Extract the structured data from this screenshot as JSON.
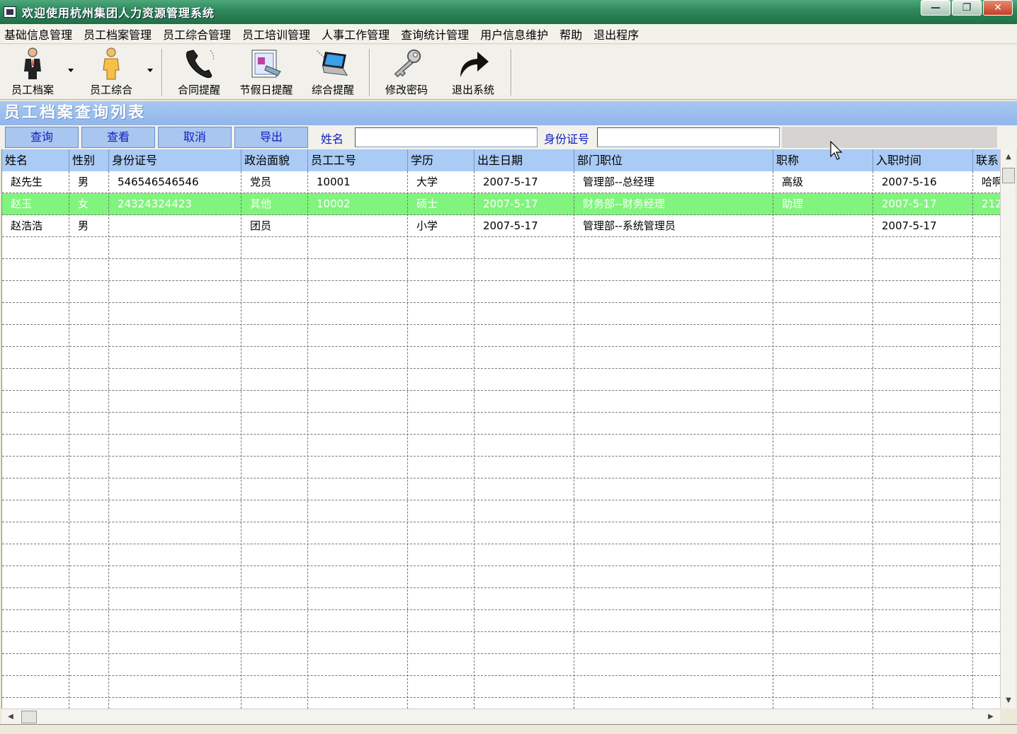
{
  "window": {
    "title": "欢迎使用杭州集团人力资源管理系统",
    "buttons": {
      "minimize": "—",
      "maximize": "❐",
      "close": "✕"
    }
  },
  "menu": [
    "基础信息管理",
    "员工档案管理",
    "员工综合管理",
    "员工培训管理",
    "人事工作管理",
    "查询统计管理",
    "用户信息维护",
    "帮助",
    "退出程序"
  ],
  "toolbar": {
    "employee_file": "员工档案",
    "employee_general": "员工综合",
    "contract_reminder": "合同提醒",
    "holiday_reminder": "节假日提醒",
    "general_reminder": "综合提醒",
    "change_password": "修改密码",
    "exit_system": "退出系统"
  },
  "section": {
    "title": "员工档案查询列表"
  },
  "actions": {
    "query": "查询",
    "view": "查看",
    "cancel": "取消",
    "export": "导出",
    "name_label": "姓名",
    "name_value": "",
    "idcard_label": "身份证号",
    "idcard_value": ""
  },
  "grid": {
    "columns": [
      "姓名",
      "性别",
      "身份证号",
      "政治面貌",
      "员工工号",
      "学历",
      "出生日期",
      "部门职位",
      "职称",
      "入职时间",
      "联系"
    ],
    "rows": [
      [
        "赵先生",
        "男",
        "546546546546",
        "党员",
        "10001",
        "大学",
        "2007-5-17",
        "管理部--总经理",
        "高级",
        "2007-5-16",
        "哈啊"
      ],
      [
        "赵玉",
        "女",
        "24324324423",
        "其他",
        "10002",
        "硕士",
        "2007-5-17",
        "财务部--财务经理",
        "助理",
        "2007-5-17",
        "212"
      ],
      [
        "赵浩浩",
        "男",
        "",
        "团员",
        "",
        "小学",
        "2007-5-17",
        "管理部--系统管理员",
        "",
        "2007-5-17",
        ""
      ]
    ],
    "selected_row": 1,
    "selected_color": "#80f47c",
    "header_color": "#aacbf5"
  }
}
